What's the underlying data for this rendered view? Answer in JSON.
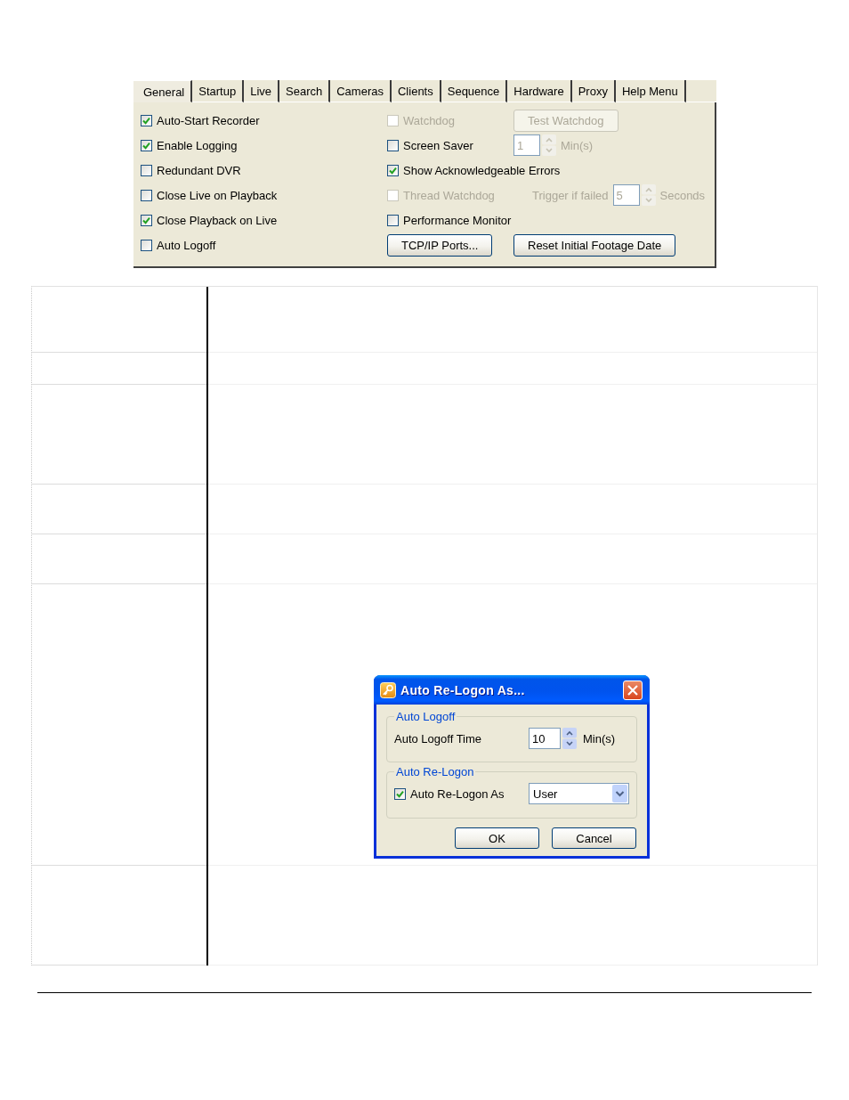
{
  "settings_panel": {
    "tabs": [
      {
        "label": "General",
        "selected": true
      },
      {
        "label": "Startup",
        "selected": false
      },
      {
        "label": "Live",
        "selected": false
      },
      {
        "label": "Search",
        "selected": false
      },
      {
        "label": "Cameras",
        "selected": false
      },
      {
        "label": "Clients",
        "selected": false
      },
      {
        "label": "Sequence",
        "selected": false
      },
      {
        "label": "Hardware",
        "selected": false
      },
      {
        "label": "Proxy",
        "selected": false
      },
      {
        "label": "Help Menu",
        "selected": false
      }
    ],
    "left_options": [
      {
        "label": "Auto-Start Recorder",
        "checked": true
      },
      {
        "label": "Enable Logging",
        "checked": true
      },
      {
        "label": "Redundant DVR",
        "checked": false
      },
      {
        "label": "Close Live on Playback",
        "checked": false
      },
      {
        "label": "Close Playback on Live",
        "checked": true
      },
      {
        "label": "Auto Logoff",
        "checked": false
      }
    ],
    "right_rows": [
      {
        "controls": [
          {
            "kind": "checkbox",
            "label": "Watchdog",
            "checked": false,
            "disabled": true
          },
          {
            "kind": "button",
            "label": "Test Watchdog",
            "disabled": true
          }
        ]
      },
      {
        "controls": [
          {
            "kind": "checkbox",
            "label": "Screen Saver",
            "checked": false,
            "disabled": false
          },
          {
            "kind": "spin",
            "value": "1",
            "disabled": true
          },
          {
            "kind": "label",
            "label": "Min(s)",
            "disabled": true
          }
        ]
      },
      {
        "controls": [
          {
            "kind": "checkbox",
            "label": "Show Acknowledgeable Errors",
            "checked": true,
            "disabled": false
          }
        ]
      },
      {
        "controls": [
          {
            "kind": "checkbox",
            "label": "Thread Watchdog",
            "checked": false,
            "disabled": true
          },
          {
            "kind": "label",
            "label": "Trigger if failed",
            "disabled": true
          },
          {
            "kind": "spin",
            "value": "5",
            "disabled": true
          },
          {
            "kind": "label",
            "label": "Seconds",
            "disabled": true
          }
        ]
      },
      {
        "controls": [
          {
            "kind": "checkbox",
            "label": "Performance Monitor",
            "checked": false,
            "disabled": false
          }
        ]
      },
      {
        "controls": [
          {
            "kind": "button",
            "label": "TCP/IP Ports...",
            "disabled": false
          },
          {
            "kind": "button",
            "label": "Reset Initial Footage Date",
            "disabled": false
          }
        ]
      }
    ]
  },
  "table": {
    "rows": [
      {
        "kind": "blank"
      },
      {
        "kind": "blank"
      },
      {
        "kind": "blank"
      },
      {
        "kind": "blank"
      },
      {
        "kind": "blank"
      },
      {
        "kind": "dialog",
        "dialog": {
          "title": "Auto Re-Logon As...",
          "auto_logoff": {
            "legend": "Auto Logoff",
            "label": "Auto Logoff Time",
            "value": "10",
            "unit": "Min(s)"
          },
          "auto_relogon": {
            "legend": "Auto Re-Logon",
            "checkbox": {
              "label": "Auto Re-Logon As",
              "checked": true
            },
            "dropdown": {
              "value": "User"
            }
          },
          "buttons": [
            "OK",
            "Cancel"
          ]
        }
      },
      {
        "kind": "blank"
      }
    ]
  }
}
